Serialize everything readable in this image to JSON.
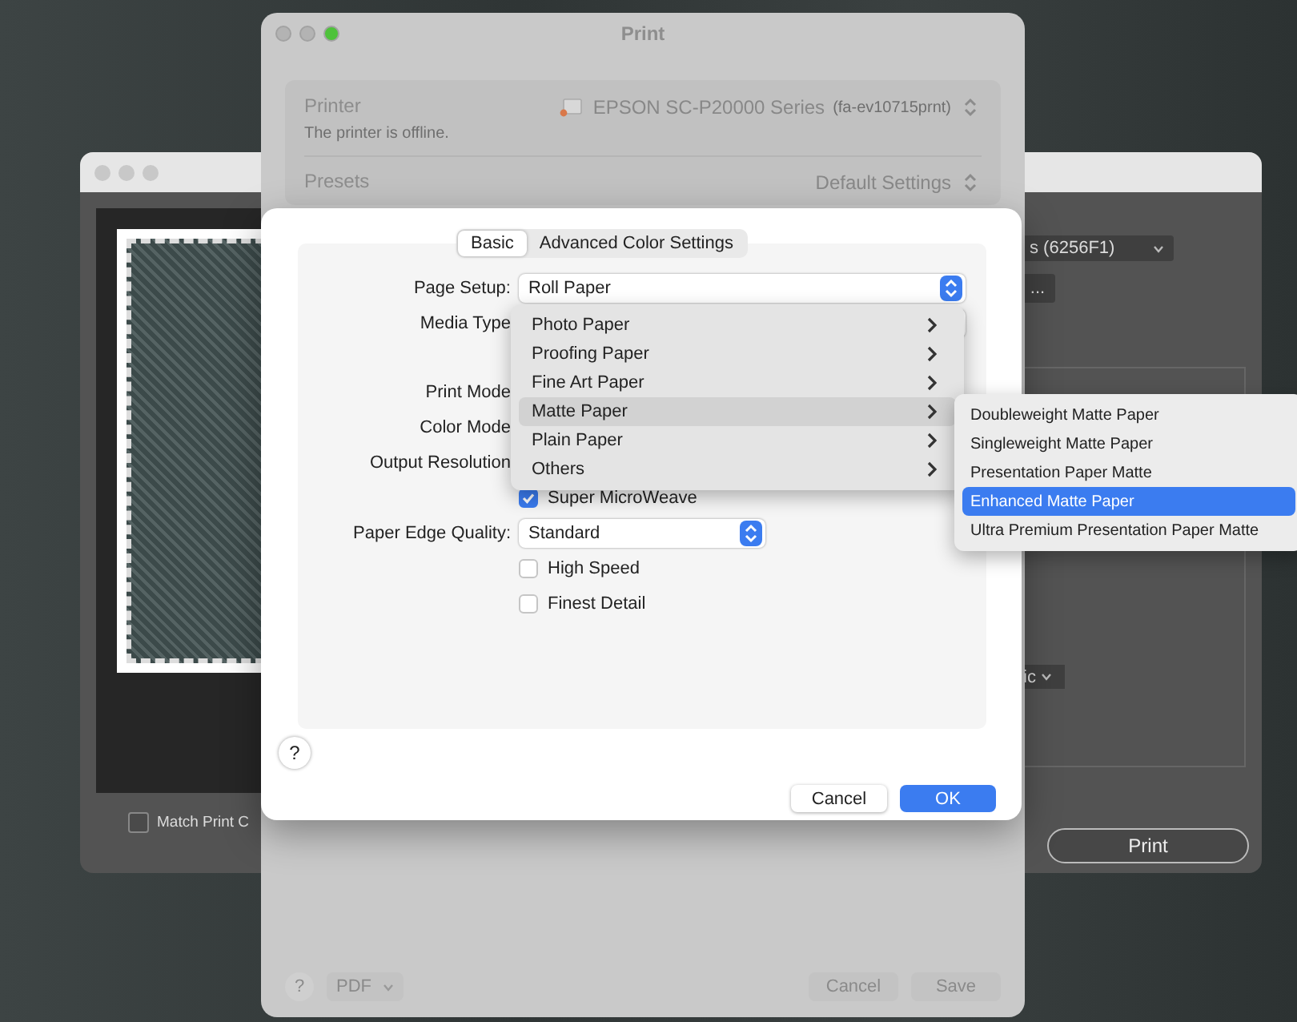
{
  "background_window": {
    "device_dropdown": "s (6256F1)",
    "more_button": "...",
    "mode_dropdown": "ic",
    "match_checkbox": {
      "label": "Match Print C",
      "checked": false
    },
    "print_button": "Print"
  },
  "print_dialog": {
    "title": "Print",
    "printer_label": "Printer",
    "printer_status": "The printer is offline.",
    "printer_name": "EPSON SC-P20000 Series",
    "printer_id": "(fa-ev10715prnt)",
    "presets_label": "Presets",
    "presets_value": "Default Settings",
    "help": "?",
    "pdf_button": "PDF",
    "buttons": [
      "Cancel",
      "Save"
    ]
  },
  "sheet": {
    "tabs": [
      {
        "label": "Basic",
        "selected": true
      },
      {
        "label": "Advanced Color Settings",
        "selected": false
      }
    ],
    "fields": [
      {
        "kind": "select",
        "label": "Page Setup:",
        "value": "Roll Paper"
      },
      {
        "kind": "select",
        "label": "Media Type"
      },
      {
        "kind": "label",
        "label": "Print Mode"
      },
      {
        "kind": "label",
        "label": "Color Mode"
      },
      {
        "kind": "label",
        "label": "Output Resolution"
      },
      {
        "kind": "checkbox",
        "label": "Super MicroWeave",
        "checked": true
      },
      {
        "kind": "select",
        "label": "Paper Edge Quality:",
        "value": "Standard"
      },
      {
        "kind": "checkbox",
        "label": "High Speed",
        "checked": false
      },
      {
        "kind": "checkbox",
        "label": "Finest Detail",
        "checked": false
      }
    ],
    "help": "?",
    "buttons": [
      {
        "label": "Cancel",
        "kind": "secondary"
      },
      {
        "label": "OK",
        "kind": "primary"
      }
    ]
  },
  "media_menu": {
    "items": [
      {
        "label": "Photo Paper",
        "selected": false
      },
      {
        "label": "Proofing Paper",
        "selected": false
      },
      {
        "label": "Fine Art Paper",
        "selected": false
      },
      {
        "label": "Matte Paper",
        "selected": true
      },
      {
        "label": "Plain Paper",
        "selected": false
      },
      {
        "label": "Others",
        "selected": false
      }
    ]
  },
  "submenu": {
    "items": [
      {
        "label": "Doubleweight Matte Paper",
        "selected": false
      },
      {
        "label": "Singleweight Matte Paper",
        "selected": false
      },
      {
        "label": "Presentation Paper Matte",
        "selected": false
      },
      {
        "label": "Enhanced Matte Paper",
        "selected": true
      },
      {
        "label": "Ultra Premium Presentation Paper Matte",
        "selected": false
      }
    ]
  }
}
